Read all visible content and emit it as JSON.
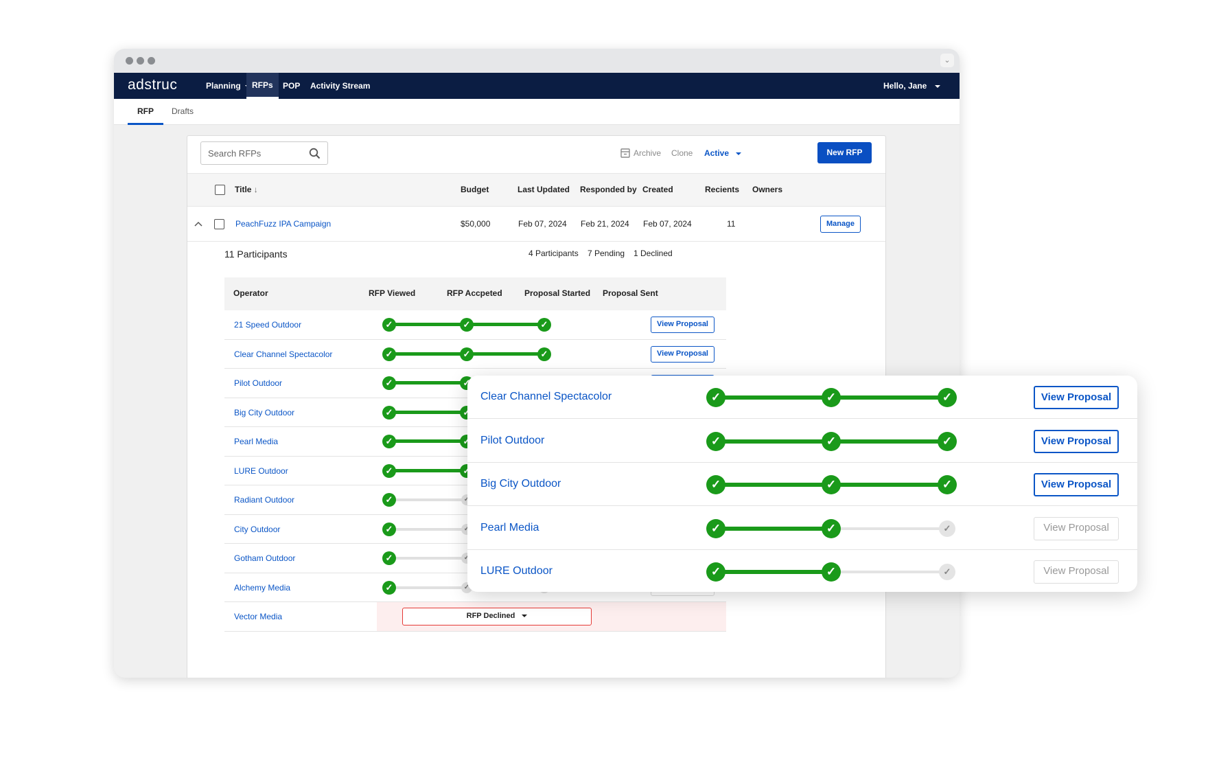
{
  "brand": "adstruc",
  "nav": {
    "items": [
      {
        "label": "Planning",
        "dropdown": true
      },
      {
        "label": "RFPs",
        "active": true
      },
      {
        "label": "POP"
      },
      {
        "label": "Activity Stream"
      }
    ],
    "user": "Hello, Jane"
  },
  "subtabs": [
    {
      "label": "RFP",
      "active": true
    },
    {
      "label": "Drafts"
    }
  ],
  "toolbar": {
    "search_placeholder": "Search RFPs",
    "archive": "Archive",
    "clone": "Clone",
    "status": "Active",
    "new_rfp": "New RFP"
  },
  "table": {
    "columns": [
      "Title",
      "Budget",
      "Last Updated",
      "Responded by",
      "Created",
      "Recients",
      "Owners"
    ],
    "rows": [
      {
        "title": "PeachFuzz IPA Campaign",
        "budget": "$50,000",
        "last_updated": "Feb 07, 2024",
        "responded_by": "Feb 21, 2024",
        "created": "Feb 07, 2024",
        "recipients": "11",
        "owners_action": "Manage"
      }
    ]
  },
  "participants": {
    "heading": "11 Participants",
    "stats": {
      "participants": "4 Participants",
      "pending": "7 Pending",
      "declined": "1 Declined"
    },
    "columns": [
      "Operator",
      "RFP Viewed",
      "RFP Accpeted",
      "Proposal Started",
      "Proposal Sent"
    ],
    "view_label": "View Proposal",
    "declined_label": "RFP Declined",
    "rows": [
      {
        "name": "21 Speed Outdoor",
        "progress": 3,
        "proposal_active": true
      },
      {
        "name": "Clear Channel Spectacolor",
        "progress": 3,
        "proposal_active": true
      },
      {
        "name": "Pilot Outdoor",
        "progress": 3,
        "proposal_active": true
      },
      {
        "name": "Big City Outdoor",
        "progress": 3,
        "proposal_active": true
      },
      {
        "name": "Pearl Media",
        "progress": 2,
        "proposal_active": false
      },
      {
        "name": "LURE Outdoor",
        "progress": 2,
        "proposal_active": false
      },
      {
        "name": "Radiant Outdoor",
        "progress": 1,
        "proposal_active": false
      },
      {
        "name": "City Outdoor",
        "progress": 1,
        "proposal_active": false
      },
      {
        "name": "Gotham Outdoor",
        "progress": 1,
        "proposal_active": false
      },
      {
        "name": "Alchemy Media",
        "progress": 1,
        "proposal_active": false
      },
      {
        "name": "Vector Media",
        "declined": true
      }
    ]
  },
  "zoom": {
    "rows": [
      {
        "name": "Clear Channel Spectacolor",
        "progress": 3,
        "proposal_active": true
      },
      {
        "name": "Pilot Outdoor",
        "progress": 3,
        "proposal_active": true
      },
      {
        "name": "Big City Outdoor",
        "progress": 3,
        "proposal_active": true
      },
      {
        "name": "Pearl Media",
        "progress": 2,
        "proposal_active": false
      },
      {
        "name": "LURE Outdoor",
        "progress": 2,
        "proposal_active": false
      }
    ]
  },
  "colors": {
    "navy": "#0b1d43",
    "primary": "#0a4fc2",
    "link": "#0a55c6",
    "success": "#1a9a1a",
    "danger": "#e53935"
  }
}
